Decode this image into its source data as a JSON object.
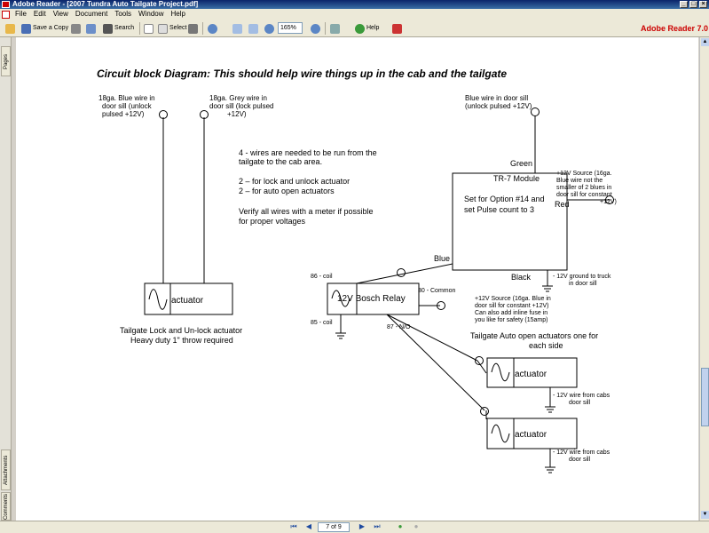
{
  "window": {
    "title": "Adobe Reader - [2007 Tundra Auto Tailgate Project.pdf]"
  },
  "menu": [
    "File",
    "Edit",
    "View",
    "Document",
    "Tools",
    "Window",
    "Help"
  ],
  "toolbar": {
    "save_copy": "Save a Copy",
    "search": "Search",
    "select": "Select",
    "zoom": "165%",
    "help": "Help"
  },
  "brand": "Adobe Reader 7.0",
  "left_tabs": {
    "pages": "Pages",
    "attachments": "Attachments",
    "comments": "Comments"
  },
  "nav": {
    "page_indicator": "7 of 9"
  },
  "diagram": {
    "title": "Circuit block Diagram: This should help wire things up in the cab and the tailgate",
    "blue_wire": [
      "18ga. Blue wire in",
      "door sill (unlock",
      "pulsed +12V)"
    ],
    "grey_wire": [
      "18ga. Grey wire in",
      "door sill (lock pulsed",
      "+12V)"
    ],
    "notes": [
      "4 - wires are needed to be run from the",
      "tailgate to the cab area.",
      "2 – for lock and unlock actuator",
      "2 – for auto open actuators",
      "Verify all wires with a meter if possible",
      "for proper voltages"
    ],
    "door_sill_blue": [
      "Blue wire in door sill",
      "(unlock pulsed +12V)"
    ],
    "green": "Green",
    "module": [
      "TR-7 Module",
      "Set for Option #14 and",
      "set Pulse count to 3"
    ],
    "source_top": [
      "+12V Source (16ga.",
      "Blue wire not the",
      "smaller of 2 blues in",
      "door sill for constant",
      "+12V)"
    ],
    "red": "Red",
    "blue": "Blue",
    "black": "Black",
    "ground_truck": [
      "- 12V ground to truck",
      "in door sill"
    ],
    "coil86": "86 - coil",
    "common30": "30 - Common",
    "relay": "12V Bosch Relay",
    "coil85": "85 - coil",
    "no87": "87 - N/O",
    "source_mid": [
      "+12V Source (16ga. Blue in",
      "door sill for constant +12V)",
      "Can also add inline fuse in",
      "you like for safety (15amp)"
    ],
    "actuator": "actuator",
    "lock_caption": [
      "Tailgate Lock and Un-lock actuator",
      "Heavy duty 1\" throw required"
    ],
    "auto_caption": [
      "Tailgate Auto open actuators one for",
      "each side"
    ],
    "cab_wire": [
      "- 12V wire from cabs",
      "door sill"
    ]
  }
}
